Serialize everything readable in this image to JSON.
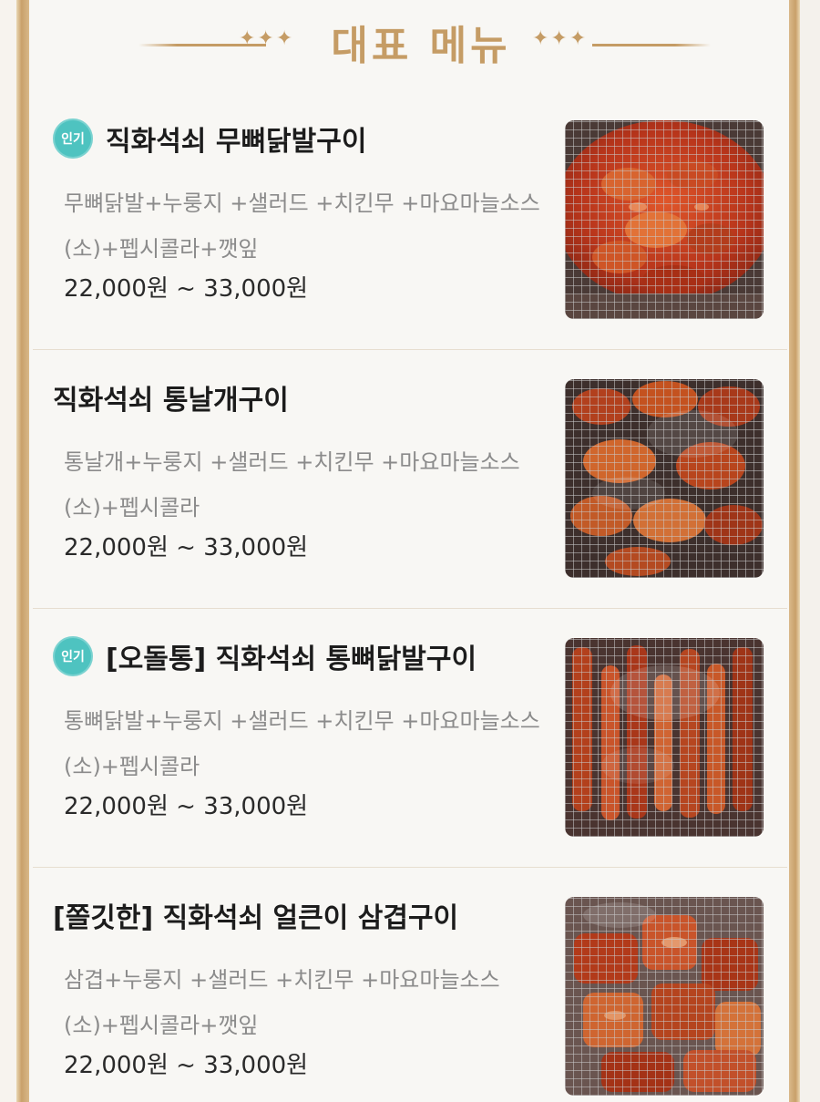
{
  "header": {
    "title": "대표 메뉴",
    "left_ornament": "✦✦✦",
    "right_ornament": "✦✦✦"
  },
  "menu": {
    "items": [
      {
        "badge": "인기",
        "name": "직화석쇠 무뼈닭발구이",
        "description": "무뼈닭발+누룽지 +샐러드 +치킨무 +마요마늘소스(소)+펩시콜라+깻잎",
        "price": "22,000원 ~ 33,000원",
        "image": "boneless-chicken-feet-grill-photo"
      },
      {
        "badge": "",
        "name": "직화석쇠 통날개구이",
        "description": "통날개+누룽지 +샐러드 +치킨무 +마요마늘소스(소)+펩시콜라",
        "price": "22,000원 ~ 33,000원",
        "image": "chicken-wings-grill-photo"
      },
      {
        "badge": "인기",
        "name": "[오돌통] 직화석쇠 통뼈닭발구이",
        "description": "통뼈닭발+누룽지 +샐러드 +치킨무 +마요마늘소스(소)+펩시콜라",
        "price": "22,000원 ~ 33,000원",
        "image": "bone-in-chicken-feet-grill-photo"
      },
      {
        "badge": "",
        "name": "[쫄깃한] 직화석쇠 얼큰이 삼겹구이",
        "description": "삼겹+누룽지 +샐러드 +치킨무 +마요마늘소스(소)+펩시콜라+깻잎",
        "price": "22,000원 ~ 33,000원",
        "image": "spicy-pork-belly-grill-photo"
      }
    ]
  },
  "colors": {
    "accent_gold": "#c59c65",
    "badge_teal": "#4ec3c0",
    "description_gray": "#8b8b8b"
  }
}
